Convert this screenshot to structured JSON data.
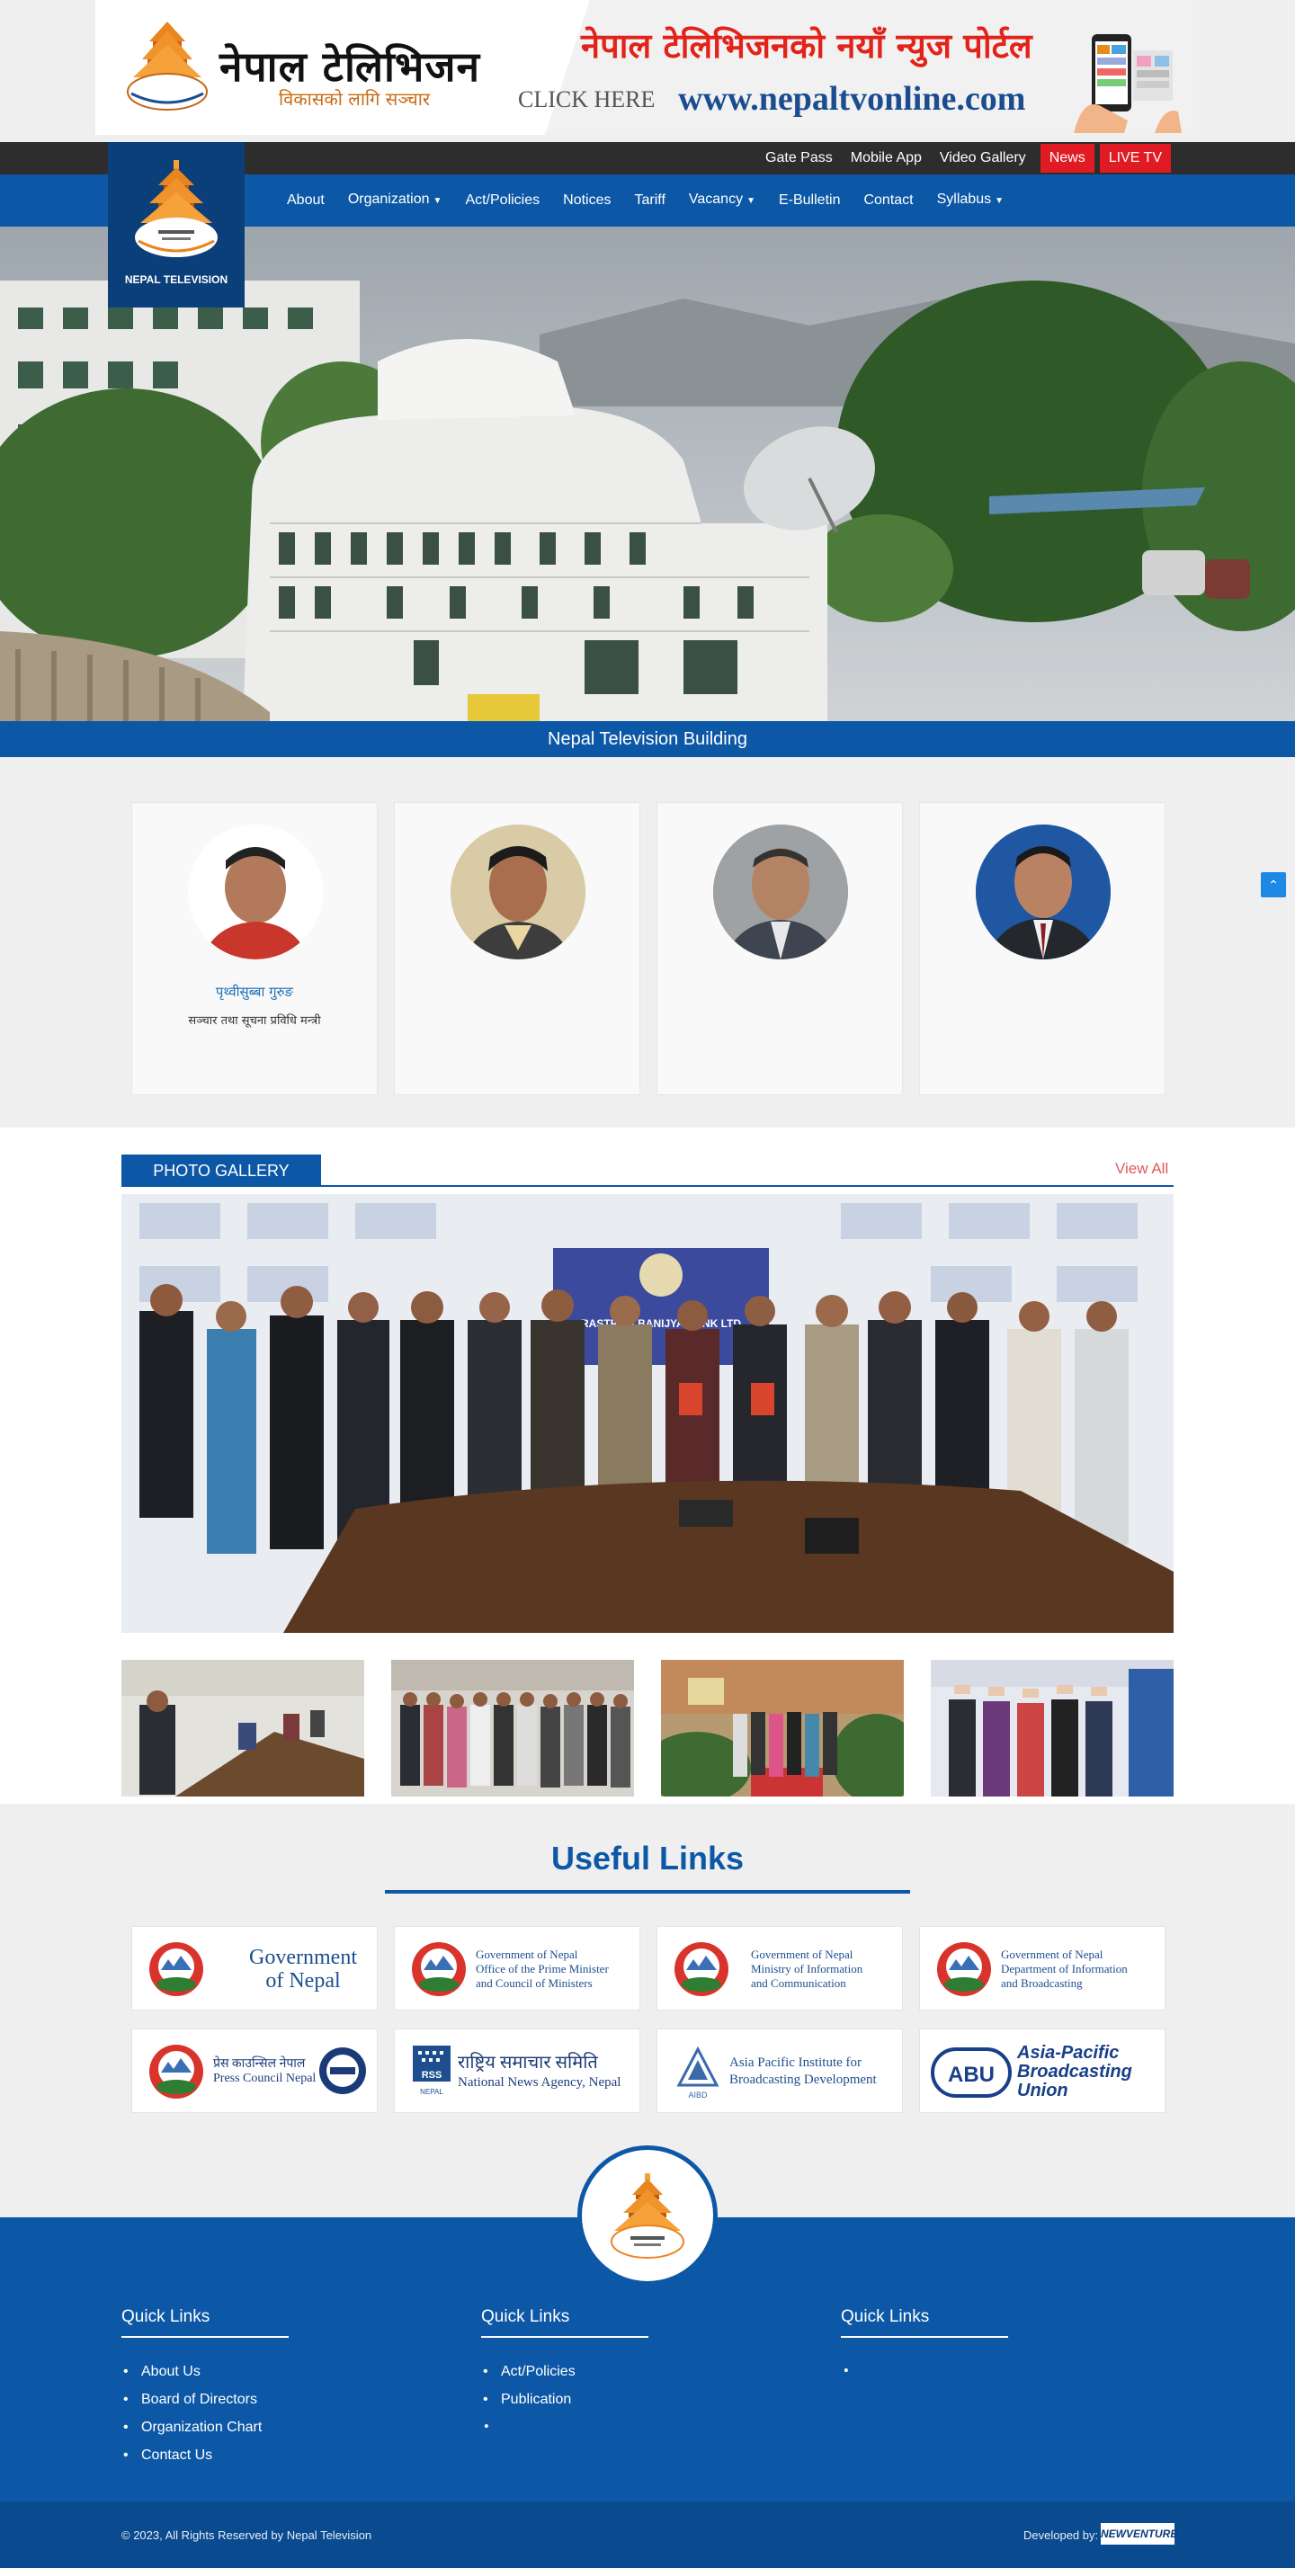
{
  "banner": {
    "title": "नेपाल टेलिभिजन",
    "tagline": "विकासको लागि सञ्चार",
    "headline": "नेपाल टेलिभिजनको नयाँ न्युज पोर्टल",
    "click_here": "CLICK HERE",
    "url": "www.nepaltvonline.com"
  },
  "utility_nav": {
    "items": [
      "Gate Pass",
      "Mobile App",
      "Video Gallery"
    ],
    "news": "News",
    "live": "LIVE TV"
  },
  "logo": {
    "name": "NEPAL TELEVISION"
  },
  "main_nav": {
    "items": [
      {
        "label": "About"
      },
      {
        "label": "Organization",
        "dropdown": true
      },
      {
        "label": "Act/Policies"
      },
      {
        "label": "Notices"
      },
      {
        "label": "Tariff"
      },
      {
        "label": "Vacancy",
        "dropdown": true
      },
      {
        "label": "E-Bulletin"
      },
      {
        "label": "Contact"
      },
      {
        "label": "Syllabus",
        "dropdown": true
      }
    ]
  },
  "hero": {
    "caption": "Nepal Television Building"
  },
  "leaders": [
    {
      "name": "पृथ्वीसुब्बा गुरुङ",
      "role": "सञ्चार तथा सूचना प्रविधि मन्त्री",
      "extra": "",
      "extra2": ""
    },
    {
      "name": "",
      "role": "",
      "extra": "",
      "extra2": ""
    },
    {
      "name": "",
      "role": "",
      "extra": "",
      "extra2": ""
    },
    {
      "name": "",
      "role": "",
      "extra": "",
      "extra2": ""
    }
  ],
  "gallery": {
    "title": "PHOTO GALLERY",
    "view_all": "View All",
    "featured_sign": "RASTRIYA BANIJYA BANK LTD"
  },
  "useful_links": {
    "title": "Useful Links",
    "items": [
      {
        "lines": [
          "Government",
          "of Nepal"
        ]
      },
      {
        "lines": [
          "Government of Nepal",
          "Office of the Prime Minister",
          "and Council of Ministers"
        ]
      },
      {
        "lines": [
          "Government of Nepal",
          "Ministry of Information",
          "and Communication"
        ]
      },
      {
        "lines": [
          "Government of Nepal",
          "Department of Information",
          "and Broadcasting"
        ]
      },
      {
        "lines": [
          "प्रेस काउन्सिल नेपाल",
          "Press Council Nepal"
        ]
      },
      {
        "lines": [
          "राष्ट्रिय समाचार समिति",
          "National News Agency, Nepal"
        ]
      },
      {
        "lines": [
          "Asia Pacific Institute for",
          "Broadcasting Development"
        ]
      },
      {
        "lines": [
          "Asia-Pacific",
          "Broadcasting",
          "Union"
        ]
      }
    ]
  },
  "footer": {
    "col1": {
      "title": "Quick Links",
      "items": [
        "About Us",
        "Board of Directors",
        "Organization Chart",
        "Contact Us"
      ]
    },
    "col2": {
      "title": "Quick Links",
      "items": [
        "Act/Policies",
        "Publication",
        "",
        ""
      ]
    },
    "col3": {
      "title": "Quick Links",
      "items": [
        "",
        "",
        "",
        ""
      ]
    },
    "copyright": "© 2023, All Rights Reserved by Nepal Television",
    "developed_by": "Developed by:",
    "developer": "NEWVENTURE"
  },
  "colors": {
    "primary": "#0d58a6",
    "live": "#e01b24",
    "dark_bar": "#2d2d2d",
    "accent_orange": "#e58b1a"
  }
}
